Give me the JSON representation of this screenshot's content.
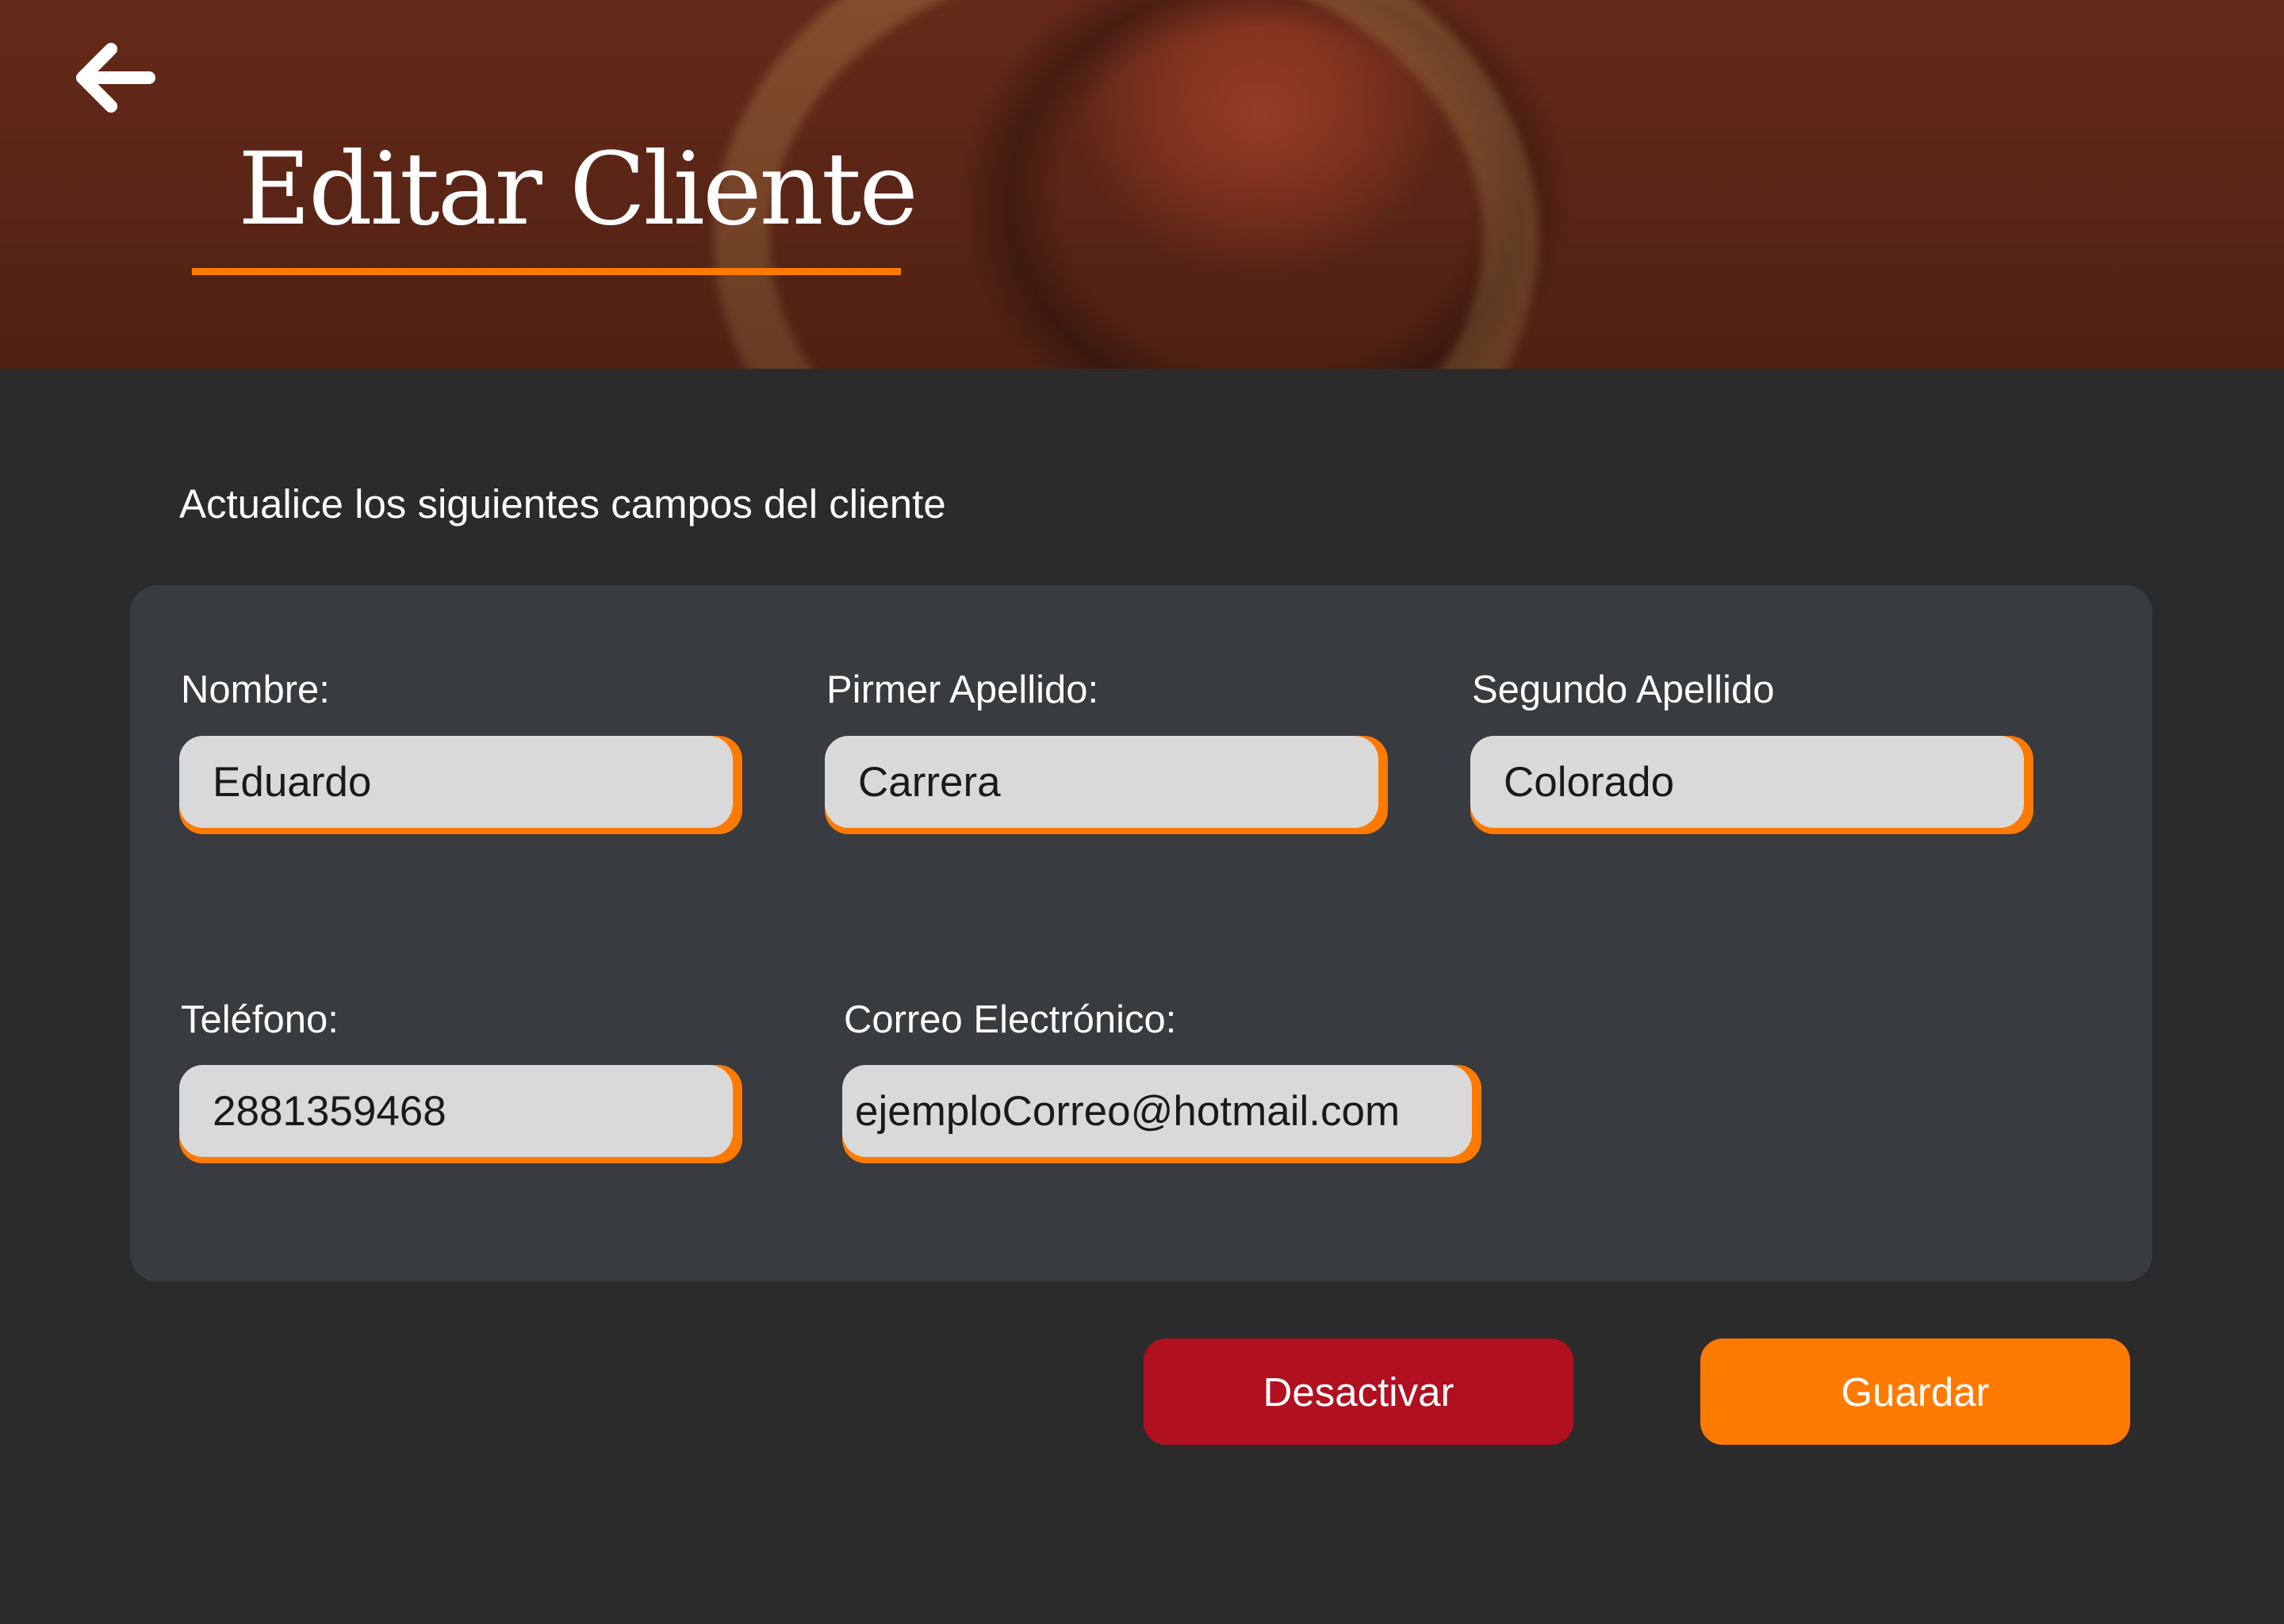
{
  "header": {
    "title": "Editar Cliente",
    "back_icon": "arrow-left-icon"
  },
  "form": {
    "instructions": "Actualice los siguientes campos del cliente",
    "fields": {
      "nombre": {
        "label": "Nombre:",
        "value": "Eduardo"
      },
      "primer_apellido": {
        "label": "Pirmer Apellido:",
        "value": "Carrera"
      },
      "segundo_apellido": {
        "label": "Segundo Apellido",
        "value": "Colorado"
      },
      "telefono": {
        "label": "Teléfono:",
        "value": "2881359468"
      },
      "correo": {
        "label": "Correo Electrónico:",
        "value": "ejemploCorreo@hotmail.com"
      }
    }
  },
  "actions": {
    "deactivate_label": "Desactivar",
    "save_label": "Guardar"
  },
  "colors": {
    "accent": "#ff7a00",
    "danger": "#b01020",
    "background": "#2b2b2c",
    "panel": "#383b40",
    "input": "#d9d9d9"
  }
}
